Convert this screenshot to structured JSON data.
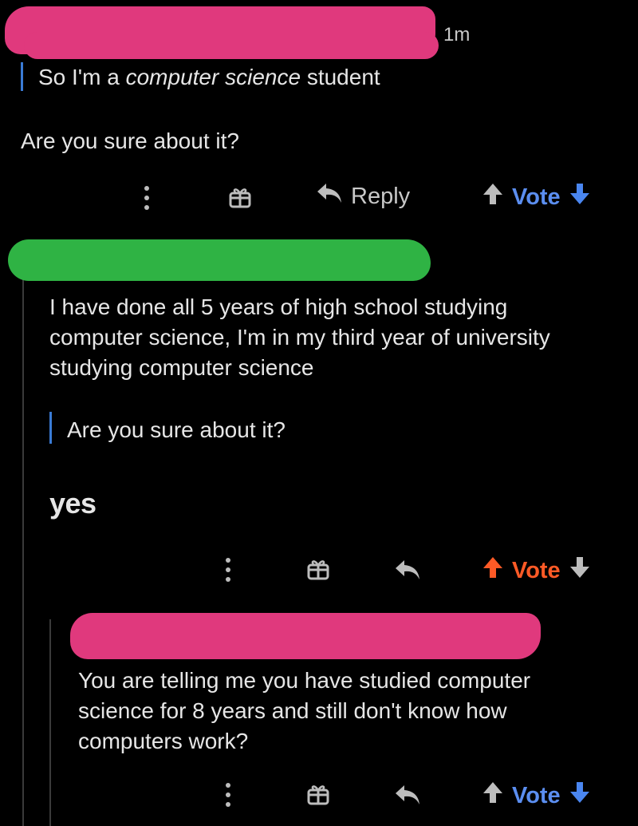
{
  "comment1": {
    "timestamp": "1m",
    "quote": {
      "prefix": "So I'm a ",
      "italic": "computer science",
      "suffix": " student"
    },
    "body": "Are you sure about it?",
    "actions": {
      "reply_label": "Reply",
      "vote_label": "Vote"
    }
  },
  "comment2": {
    "body_lines": [
      "I have done all 5 years of high school studying",
      "computer science, I'm in my third year of university",
      "studying computer science"
    ],
    "quote": "Are you sure about it?",
    "answer": "yes",
    "actions": {
      "vote_label": "Vote"
    }
  },
  "comment3": {
    "body_lines": [
      "You are telling me you have studied computer",
      "science for 8 years and still don't know how",
      "computers work?"
    ],
    "actions": {
      "vote_label": "Vote"
    }
  },
  "colors": {
    "accent_blue": "#5b8ef0",
    "upvoted_orange": "#ff5a26",
    "redaction_pink": "#e0397d",
    "redaction_green": "#2fb344"
  },
  "icons": [
    "more-icon",
    "award-icon",
    "reply-icon",
    "upvote-icon",
    "downvote-icon"
  ]
}
